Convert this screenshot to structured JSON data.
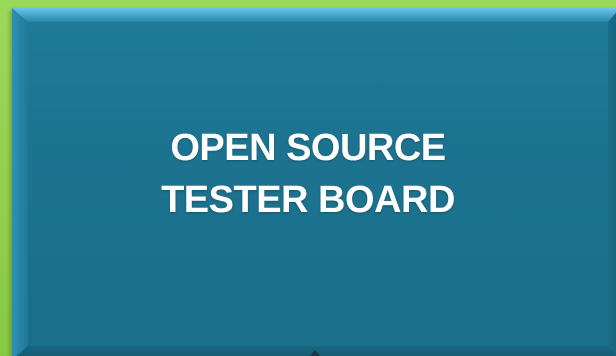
{
  "board": {
    "title_line1": "OPEN SOURCE",
    "title_line2": "TESTER BOARD",
    "colors": {
      "background": "#8fcf4c",
      "panel": "#1c7390",
      "bevel_highlight": "#6fc6e6",
      "text": "#ffffff"
    }
  }
}
